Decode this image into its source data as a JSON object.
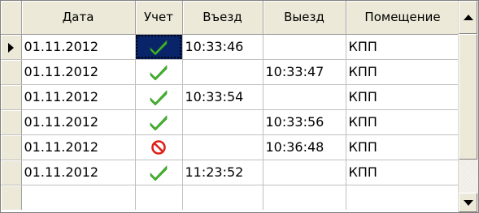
{
  "columns": {
    "date": "Дата",
    "account": "Учет",
    "entry": "Въезд",
    "exit": "Выезд",
    "room": "Помещение"
  },
  "rows": [
    {
      "date": "01.11.2012",
      "status_icon": "check-icon",
      "entry": "10:33:46",
      "exit": "",
      "room": "КПП"
    },
    {
      "date": "01.11.2012",
      "status_icon": "check-icon",
      "entry": "",
      "exit": "10:33:47",
      "room": "КПП"
    },
    {
      "date": "01.11.2012",
      "status_icon": "check-icon",
      "entry": "10:33:54",
      "exit": "",
      "room": "КПП"
    },
    {
      "date": "01.11.2012",
      "status_icon": "check-icon",
      "entry": "",
      "exit": "10:33:56",
      "room": "КПП"
    },
    {
      "date": "01.11.2012",
      "status_icon": "prohibited-icon",
      "entry": "",
      "exit": "10:36:48",
      "room": "КПП"
    },
    {
      "date": "01.11.2012",
      "status_icon": "check-icon",
      "entry": "11:23:52",
      "exit": "",
      "room": "КПП"
    }
  ],
  "colors": {
    "check": "#44b82c",
    "prohibited": "#e0201a",
    "selection": "#0a246a",
    "header_bg": "#ece9d8"
  }
}
